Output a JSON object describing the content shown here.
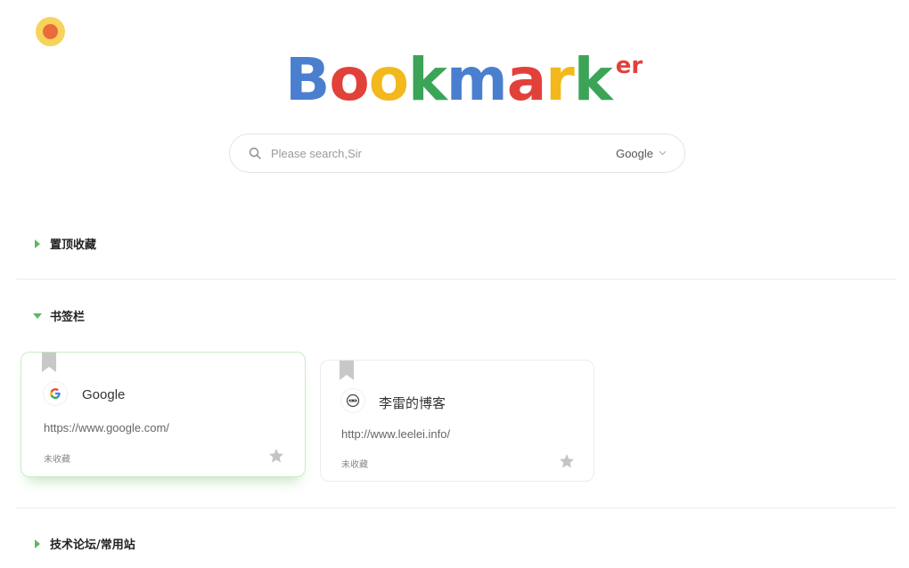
{
  "logo": {
    "letters": [
      {
        "char": "B",
        "color": "#4a7fd0"
      },
      {
        "char": "o",
        "color": "#e2413a"
      },
      {
        "char": "o",
        "color": "#f2b81c"
      },
      {
        "char": "k",
        "color": "#3ba457"
      },
      {
        "char": "m",
        "color": "#4a7fd0"
      },
      {
        "char": "a",
        "color": "#e2413a"
      },
      {
        "char": "r",
        "color": "#f2b81c"
      },
      {
        "char": "k",
        "color": "#3ba457"
      }
    ],
    "suffix": "ER",
    "suffix_color": "#e2413a"
  },
  "search": {
    "placeholder": "Please search,Sir",
    "value": "",
    "engine": "Google",
    "icon": "search-icon",
    "engine_chevron_icon": "chevron-down-icon"
  },
  "sections": [
    {
      "label": "置顶收藏",
      "expanded": false,
      "caret_icon": "caret-right-icon"
    },
    {
      "label": "书签栏",
      "expanded": true,
      "caret_icon": "caret-down-icon"
    },
    {
      "label": "技术论坛/常用站",
      "expanded": false,
      "caret_icon": "caret-right-icon"
    }
  ],
  "cards": [
    {
      "title": "Google",
      "url": "https://www.google.com/",
      "status": "未收藏",
      "icon": "google-logo-icon",
      "active": true
    },
    {
      "title": "李雷的博客",
      "url": "http://www.leelei.info/",
      "status": "未收藏",
      "icon": "blog-favicon-icon",
      "active": false
    }
  ],
  "colors": {
    "accent_green": "#5cb85c",
    "ribbon_gray": "#c8c8c8",
    "star_gray": "#c4c4c4",
    "app_dot_outer": "#f7d35b",
    "app_dot_inner": "#ea6a3a"
  }
}
